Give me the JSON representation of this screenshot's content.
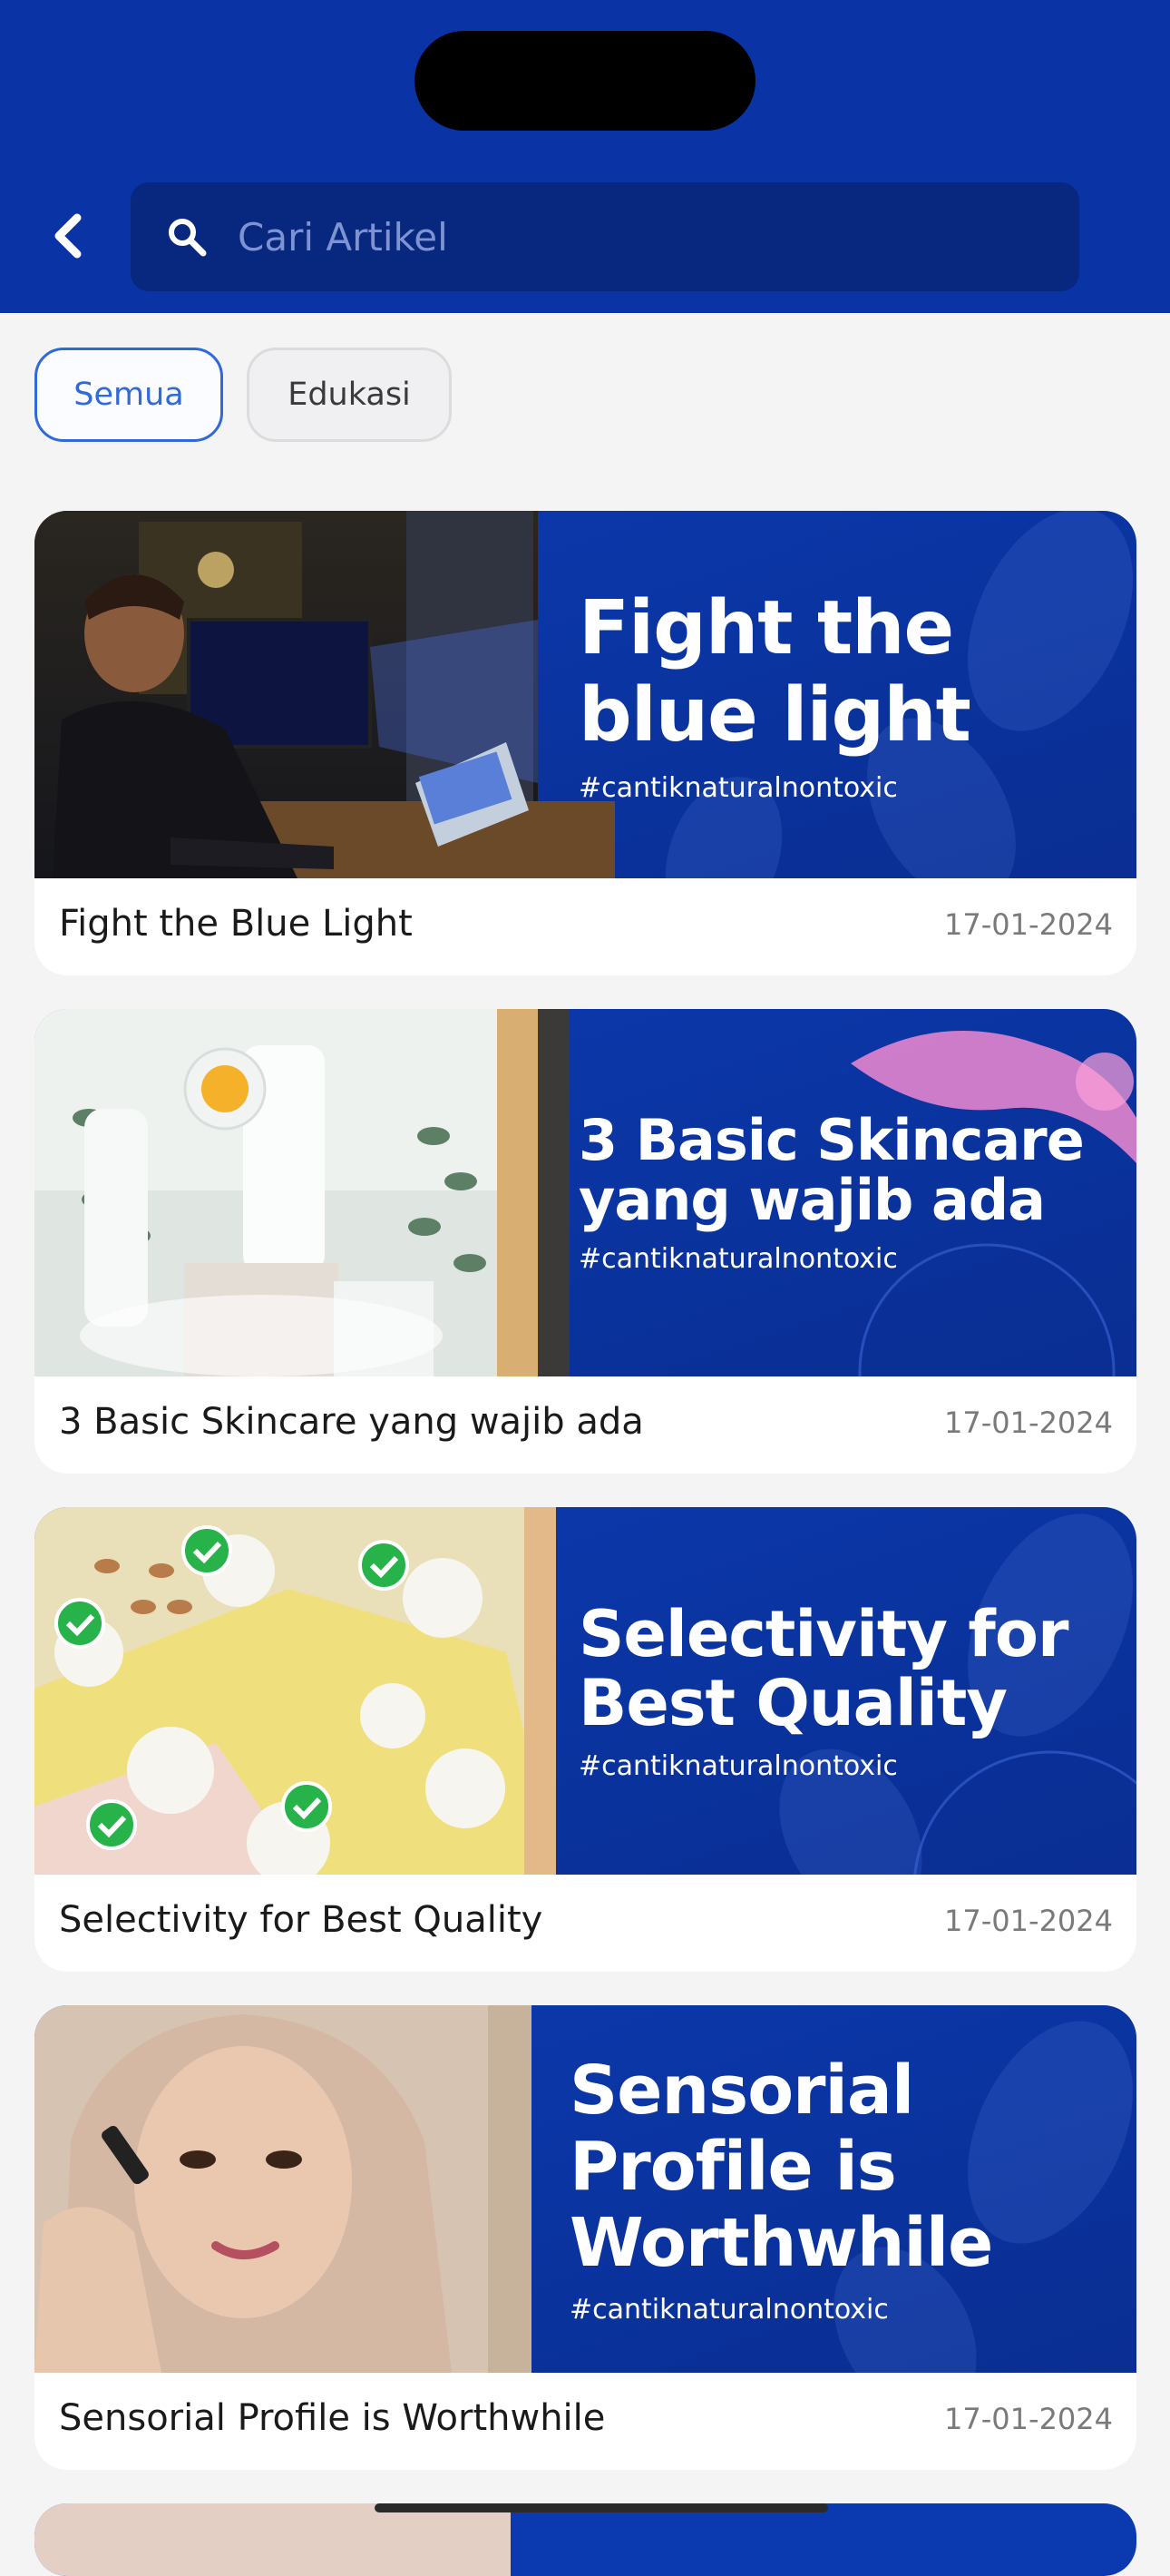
{
  "search": {
    "placeholder": "Cari Artikel"
  },
  "filters": [
    {
      "label": "Semua",
      "active": true
    },
    {
      "label": "Edukasi",
      "active": false
    }
  ],
  "articles": [
    {
      "title": "Fight the Blue Light",
      "date": "17-01-2024",
      "banner_title_lines": [
        "Fight the",
        "blue light"
      ],
      "hashtag": "#cantiknaturalnontoxic"
    },
    {
      "title": "3 Basic Skincare yang wajib ada",
      "date": "17-01-2024",
      "banner_title_lines": [
        "3 Basic Skincare",
        "yang wajib ada"
      ],
      "hashtag": "#cantiknaturalnontoxic"
    },
    {
      "title": "Selectivity for Best Quality",
      "date": "17-01-2024",
      "banner_title_lines": [
        "Selectivity for",
        "Best Quality"
      ],
      "hashtag": "#cantiknaturalnontoxic"
    },
    {
      "title": "Sensorial Profile is Worthwhile",
      "date": "17-01-2024",
      "banner_title_lines": [
        "Sensorial",
        "Profile is",
        "Worthwhile"
      ],
      "hashtag": "#cantiknaturalnontoxic"
    }
  ],
  "colors": {
    "header": "#0a33a6",
    "banner_blue": "#0d3aa8",
    "accent": "#2f6ad8"
  },
  "icons": [
    "chevron-left-icon",
    "search-icon",
    "check-icon",
    "sun-icon"
  ]
}
